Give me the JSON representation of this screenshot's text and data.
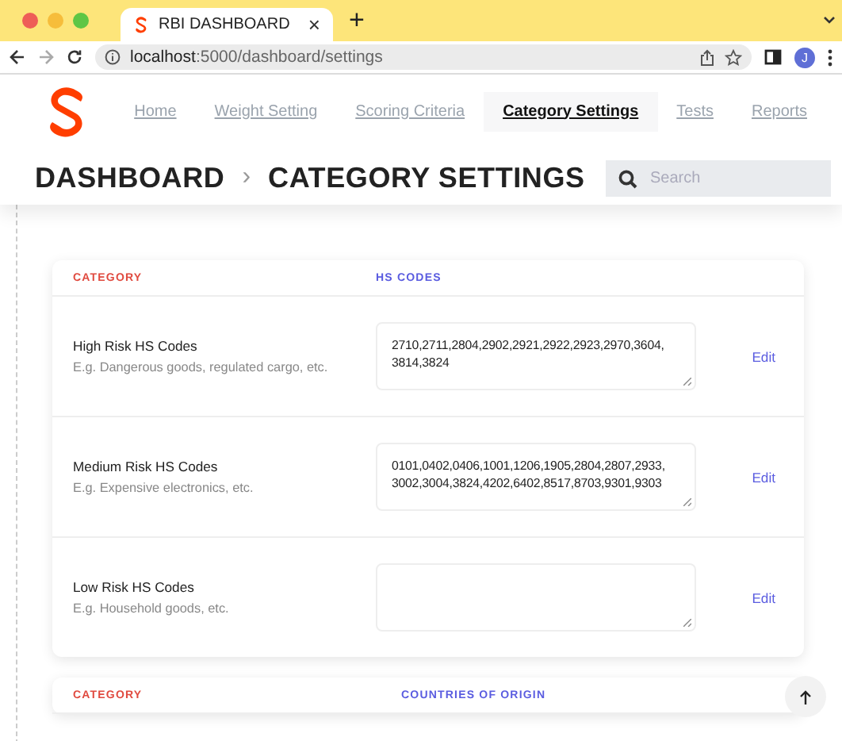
{
  "browser": {
    "tab_title": "RBI DASHBOARD",
    "tab_close": "×",
    "new_tab": "+",
    "url_host": "localhost",
    "url_path": ":5000/dashboard/settings",
    "profile_initial": "J"
  },
  "nav": {
    "items": [
      {
        "label": "Home",
        "selected": false
      },
      {
        "label": "Weight Setting",
        "selected": false
      },
      {
        "label": "Scoring Criteria",
        "selected": false
      },
      {
        "label": "Category Settings",
        "selected": true
      },
      {
        "label": "Tests",
        "selected": false
      },
      {
        "label": "Reports",
        "selected": false
      }
    ]
  },
  "page": {
    "breadcrumb": [
      "DASHBOARD",
      "CATEGORY SETTINGS"
    ],
    "separator": "›",
    "search": {
      "placeholder": "Search"
    }
  },
  "cards": [
    {
      "columns": [
        "CATEGORY",
        "HS CODES"
      ],
      "rows": [
        {
          "name": "High Risk HS Codes",
          "description": "E.g. Dangerous goods, regulated cargo, etc.",
          "value": "2710,2711,2804,2902,2921,2922,2923,2970,3604,3814,3824",
          "action": "Edit"
        },
        {
          "name": "Medium Risk HS Codes",
          "description": "E.g. Expensive electronics, etc.",
          "value": "0101,0402,0406,1001,1206,1905,2804,2807,2933,3002,3004,3824,4202,6402,8517,8703,9301,9303",
          "action": "Edit"
        },
        {
          "name": "Low Risk HS Codes",
          "description": "E.g. Household goods, etc.",
          "value": "",
          "action": "Edit"
        }
      ]
    },
    {
      "columns": [
        "CATEGORY",
        "COUNTRIES OF ORIGIN"
      ]
    }
  ]
}
